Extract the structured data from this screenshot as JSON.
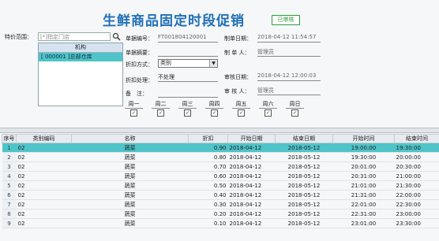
{
  "header": {
    "title": "生鲜商品固定时段促销",
    "status_badge": "已审核"
  },
  "scope": {
    "label": "特价范围：",
    "input_placeholder": "[*]指定门店",
    "list_header": "机构",
    "list_items": [
      "[ 000001 ]总部仓库"
    ]
  },
  "form": {
    "doc_no_label": "单据编号：",
    "doc_no": "FT001804120001",
    "summary_label": "单据摘要：",
    "summary": "",
    "discount_mode_label": "折扣方式：",
    "discount_mode": "类别",
    "discount_handling_label": "折扣处理：",
    "discount_handling": "不处理",
    "remark_label": "备　注：",
    "remark": "",
    "created_date_label": "制单日期：",
    "created_date": "2018-04-12 11:54:57",
    "creator_label": "制 单 人：",
    "creator": "管理员",
    "audit_date_label": "审核日期：",
    "audit_date": "2018-04-12 12:00:03",
    "auditor_label": "审 核 人：",
    "auditor": "管理员"
  },
  "weekdays": [
    {
      "label": "周一",
      "checked": true
    },
    {
      "label": "周二",
      "checked": true
    },
    {
      "label": "周三",
      "checked": true
    },
    {
      "label": "周四",
      "checked": true
    },
    {
      "label": "周五",
      "checked": true
    },
    {
      "label": "周六",
      "checked": true
    },
    {
      "label": "周日",
      "checked": true
    }
  ],
  "grid": {
    "columns": [
      "序号",
      "类别编码",
      "名称",
      "折扣",
      "开始日期",
      "结束日期",
      "开始时间",
      "结束时间"
    ],
    "rows": [
      [
        "1",
        "02",
        "蔬菜",
        "0.90",
        "2018-04-12",
        "2018-05-12",
        "19:00:00",
        "19:30:00"
      ],
      [
        "2",
        "02",
        "蔬菜",
        "0.80",
        "2018-04-12",
        "2018-05-12",
        "19:30:00",
        "20:00:00"
      ],
      [
        "3",
        "02",
        "蔬菜",
        "0.70",
        "2018-04-12",
        "2018-05-12",
        "20:01:00",
        "20:30:00"
      ],
      [
        "4",
        "02",
        "蔬菜",
        "0.60",
        "2018-04-12",
        "2018-05-12",
        "20:31:00",
        "21:00:00"
      ],
      [
        "5",
        "02",
        "蔬菜",
        "0.50",
        "2018-04-12",
        "2018-05-12",
        "21:01:00",
        "21:30:00"
      ],
      [
        "6",
        "02",
        "蔬菜",
        "0.40",
        "2018-04-12",
        "2018-05-12",
        "21:31:00",
        "22:00:00"
      ],
      [
        "7",
        "02",
        "蔬菜",
        "0.30",
        "2018-04-12",
        "2018-05-12",
        "22:01:00",
        "22:30:00"
      ],
      [
        "8",
        "02",
        "蔬菜",
        "0.20",
        "2018-04-12",
        "2018-05-12",
        "22:31:00",
        "23:00:00"
      ],
      [
        "9",
        "02",
        "蔬菜",
        "0.10",
        "2018-04-12",
        "2018-05-12",
        "23:01:00",
        "23:30:00"
      ]
    ]
  }
}
